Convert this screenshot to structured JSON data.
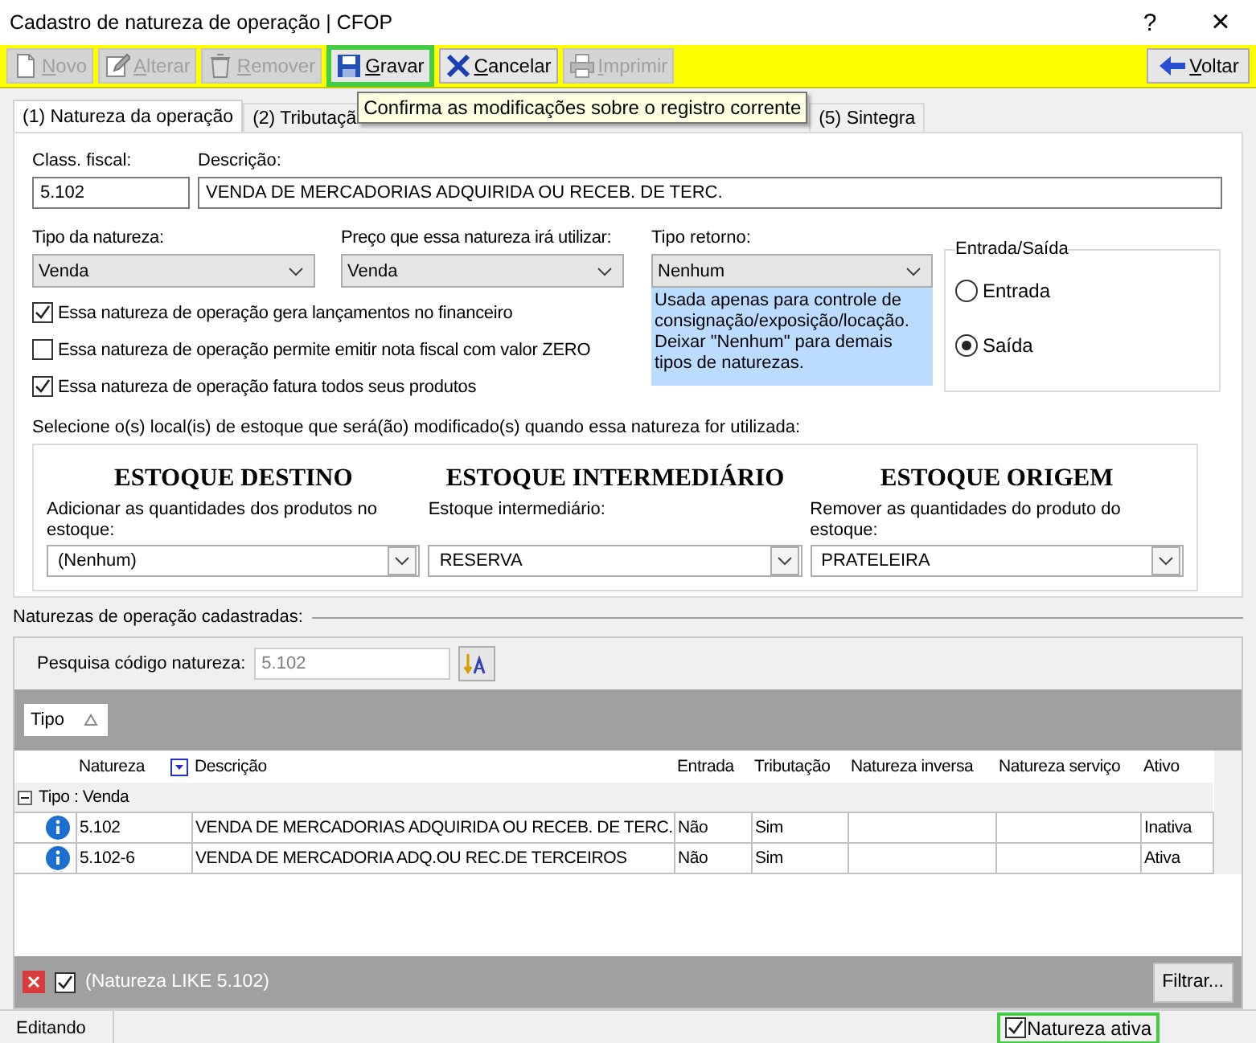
{
  "window": {
    "title": "Cadastro de natureza de operação | CFOP",
    "help": "?",
    "close": "×"
  },
  "toolbar": {
    "buttons": [
      {
        "label": "Novo",
        "disabled": true,
        "highlighted": false
      },
      {
        "label": "Alterar",
        "disabled": true,
        "highlighted": false
      },
      {
        "label": "Remover",
        "disabled": true,
        "highlighted": false
      },
      {
        "label": "Gravar",
        "disabled": false,
        "highlighted": true
      },
      {
        "label": "Cancelar",
        "disabled": false,
        "highlighted": false
      },
      {
        "label": "Imprimir",
        "disabled": true,
        "highlighted": false
      }
    ],
    "back_button": "Voltar"
  },
  "tabs": [
    {
      "label": "(1) Natureza da operação",
      "selected": true
    },
    {
      "label": "(2) Tributaçã",
      "selected": false
    },
    {
      "label": "(5) Sintegra",
      "selected": false
    }
  ],
  "tooltip": "Confirma as modificações sobre o registro corrente",
  "form": {
    "class_fiscal": {
      "label": "Class. fiscal:",
      "value": "5.102"
    },
    "descricao": {
      "label": "Descrição:",
      "value": "VENDA DE MERCADORIAS ADQUIRIDA OU RECEB. DE TERC."
    },
    "selects": [
      {
        "label": "Tipo da natureza:",
        "value": "Venda"
      },
      {
        "label": "Preço que essa natureza irá utilizar:",
        "value": "Venda"
      },
      {
        "label": "Tipo retorno:",
        "value": "Nenhum"
      }
    ],
    "tipo_retorno_hint": "Usada apenas para controle de consignação/exposição/locação. Deixar \"Nenhum\" para demais tipos de naturezas.",
    "checkboxes": [
      {
        "label": "Essa natureza de operação gera lançamentos no financeiro",
        "checked": true
      },
      {
        "label": "Essa natureza de operação permite emitir nota fiscal com valor ZERO",
        "checked": false
      },
      {
        "label": "Essa natureza de operação fatura todos seus produtos",
        "checked": true
      }
    ],
    "entrada_saida": {
      "title": "Entrada/Saída",
      "options": [
        {
          "label": "Entrada",
          "selected": false
        },
        {
          "label": "Saída",
          "selected": true
        }
      ]
    },
    "estoque": {
      "instruction": "Selecione o(s) local(is) de estoque que será(ão) modificado(s) quando essa natureza for utilizada:",
      "columns": [
        {
          "heading": "ESTOQUE DESTINO",
          "label": "Adicionar as quantidades dos produtos no estoque:",
          "value": "(Nenhum)"
        },
        {
          "heading": "ESTOQUE INTERMEDIÁRIO",
          "label": "Estoque intermediário:",
          "value": "RESERVA"
        },
        {
          "heading": "ESTOQUE ORIGEM",
          "label": "Remover as quantidades do produto do estoque:",
          "value": "PRATELEIRA"
        }
      ]
    }
  },
  "list": {
    "title": "Naturezas de operação cadastradas:",
    "search": {
      "label": "Pesquisa código natureza:",
      "placeholder": "5.102"
    },
    "group_by": "Tipo",
    "columns": [
      "Natureza",
      "Descrição",
      "Entrada",
      "Tributação",
      "Natureza inversa",
      "Natureza serviço",
      "Ativo"
    ],
    "groups": [
      {
        "label": "Tipo : Venda",
        "expanded": true,
        "rows": [
          [
            "5.102",
            "VENDA DE MERCADORIAS ADQUIRIDA OU RECEB. DE TERC.",
            "Não",
            "Sim",
            "",
            "",
            "Inativa"
          ],
          [
            "5.102-6",
            "VENDA DE MERCADORIA ADQ.OU REC.DE TERCEIROS",
            "Não",
            "Sim",
            "",
            "",
            "Ativa"
          ]
        ]
      }
    ],
    "filter": {
      "checked": true,
      "text": "(Natureza LIKE 5.102)",
      "button": "Filtrar..."
    }
  },
  "status_bar": {
    "text": "Editando",
    "active": {
      "label": "Natureza ativa",
      "checked": true,
      "highlighted": true
    }
  }
}
